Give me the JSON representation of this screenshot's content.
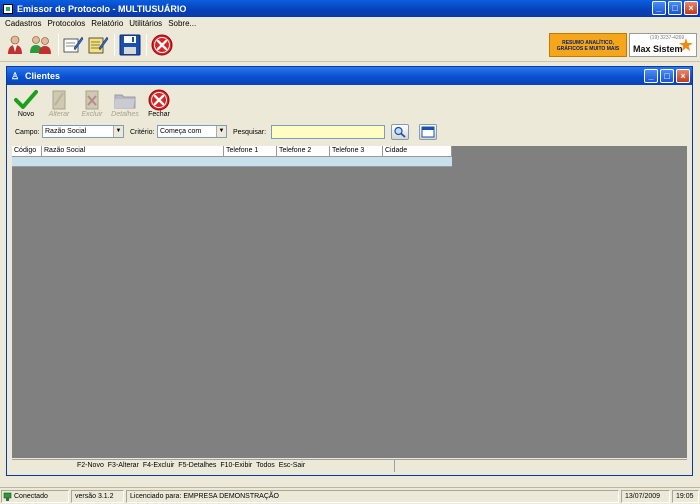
{
  "app": {
    "title": "Emissor de Protocolo - MULTIUSUÁRIO"
  },
  "menu": [
    "Cadastros",
    "Protocolos",
    "Relatório",
    "Utilitários",
    "Sobre..."
  ],
  "banner": {
    "promo": "RESUMO ANALÍTICO, GRÁFICOS E MUITO MAIS",
    "phone": "(19) 3237-4269",
    "brand": "Max Sistem"
  },
  "window": {
    "title": "Clientes"
  },
  "child_toolbar": {
    "novo": "Novo",
    "alterar": "Alterar",
    "excluir": "Excluir",
    "detalhes": "Detalhes",
    "fechar": "Fechar"
  },
  "filter": {
    "campo_label": "Campo:",
    "campo_value": "Razão Social",
    "criterio_label": "Critério:",
    "criterio_value": "Começa com",
    "pesquisar_label": "Pesquisar:",
    "pesquisar_value": ""
  },
  "table": {
    "columns": [
      "Código",
      "Razão Social",
      "Telefone 1",
      "Telefone 2",
      "Telefone 3",
      "Cidade"
    ]
  },
  "shortcuts": "F2-Novo  F3-Alterar  F4-Excluir  F5-Detalhes  F10-Exibir Todos  Esc-Sair",
  "status": {
    "connection": "Conectado",
    "version": "versão 3.1.2",
    "license": "Licenciado para: EMPRESA DEMONSTRAÇÃO",
    "date": "13/07/2009",
    "time": "19:05"
  }
}
